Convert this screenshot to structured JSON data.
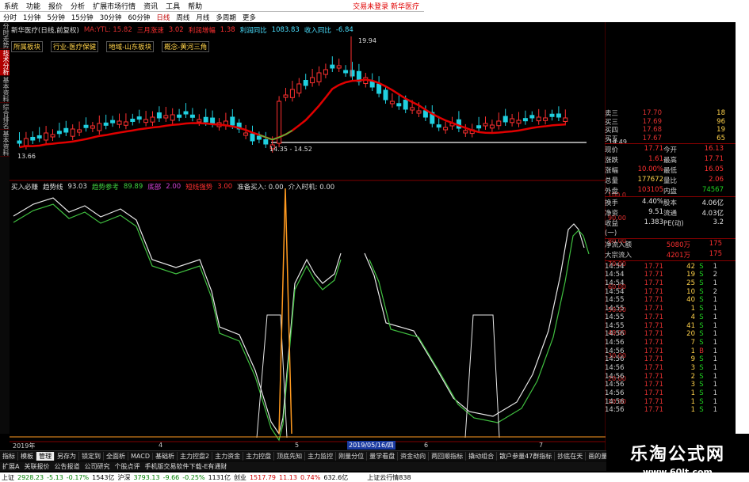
{
  "menu": {
    "items": [
      "系统",
      "功能",
      "报价",
      "分析",
      "扩展市场行情",
      "资讯",
      "工具",
      "帮助"
    ],
    "notice": "交易未登录",
    "stock_header": "新华医疗"
  },
  "periods": [
    "分时",
    "1分钟",
    "5分钟",
    "15分钟",
    "30分钟",
    "60分钟",
    "日线",
    "周线",
    "月线",
    "多周期",
    "更多"
  ],
  "left_tabs": [
    "分时走势",
    "技术分析",
    "基本资料",
    "综合排名",
    "基本资料"
  ],
  "info": {
    "title": "新华医疗(日线,前复权)",
    "ma": "MA:YTL: 15.82",
    "a": "三月涨速",
    "a_val": "3.02",
    "b": "利润增幅",
    "b_val": "1.38",
    "c": "利润同比",
    "c_val": "1083.83",
    "d": "收入同比",
    "d_val": "-6.84"
  },
  "tags": [
    "所属板块",
    "行业-医疗保健",
    "地域-山东板块",
    "概念-黄河三角"
  ],
  "indicator": {
    "name": "买入必赚",
    "trend": "趋势线",
    "trend_val": "93.03",
    "sig1": "趋势参考",
    "sig1_val": "89.89",
    "sig2": "底部",
    "sig2_val": "2.00",
    "sig3": "短线强势",
    "sig3_val": "3.00",
    "buy": "准备买入: 0.00",
    "buy2": "介入时机: 0.00"
  },
  "price_labels": {
    "high": "19.94",
    "low1": "13.66",
    "low2": "14.35 - 14.52",
    "right": "14.49"
  },
  "x_labels": {
    "a": "2019年",
    "b": "4",
    "c": "5",
    "d": "6",
    "e": "7",
    "date": "2019/05/16/四"
  },
  "osc_axis": [
    "100.0",
    "90.00",
    "80.00",
    "70.00",
    "60.00",
    "50.00",
    "40.00",
    "30.00",
    "20.00",
    "10.00"
  ],
  "quote": {
    "asks": [
      {
        "l": "卖三",
        "p": "17.70",
        "v": "18"
      },
      {
        "l": "买三",
        "p": "17.69",
        "v": "96"
      },
      {
        "l": "买四",
        "p": "17.68",
        "v": "19"
      },
      {
        "l": "买五",
        "p": "17.67",
        "v": "65"
      }
    ],
    "stats": [
      [
        "现价",
        "17.71",
        "今开",
        "16.13"
      ],
      [
        "涨跌",
        "1.61",
        "最高",
        "17.71"
      ],
      [
        "涨幅",
        "10.00%",
        "最低",
        "16.05"
      ],
      [
        "总量",
        "177672",
        "量比",
        "2.06"
      ],
      [
        "外盘",
        "103105",
        "内盘",
        "74567"
      ]
    ],
    "stats2": [
      [
        "换手",
        "4.40%",
        "股本",
        "4.06亿"
      ],
      [
        "净资",
        "9.51",
        "流通",
        "4.03亿"
      ],
      [
        "收益(一)",
        "1.383",
        "PE(动)",
        "3.2"
      ]
    ],
    "flows": [
      [
        "净流入额",
        "5080万",
        "175"
      ],
      [
        "大宗流入",
        "4201万",
        "175"
      ]
    ],
    "ticks": [
      [
        "14:54",
        "17.71",
        "42",
        "S",
        "1"
      ],
      [
        "14:54",
        "17.71",
        "19",
        "S",
        "2"
      ],
      [
        "14:54",
        "17.71",
        "25",
        "S",
        "1"
      ],
      [
        "14:54",
        "17.71",
        "10",
        "S",
        "2"
      ],
      [
        "14:55",
        "17.71",
        "40",
        "S",
        "1"
      ],
      [
        "14:55",
        "17.71",
        "1",
        "S",
        "1"
      ],
      [
        "14:55",
        "17.71",
        "4",
        "S",
        "1"
      ],
      [
        "14:55",
        "17.71",
        "41",
        "S",
        "1"
      ],
      [
        "14:56",
        "17.71",
        "20",
        "S",
        "1"
      ],
      [
        "14:56",
        "17.71",
        "7",
        "S",
        "1"
      ],
      [
        "14:56",
        "17.71",
        "1",
        "B",
        "1"
      ],
      [
        "14:56",
        "17.71",
        "9",
        "S",
        "1"
      ],
      [
        "14:56",
        "17.71",
        "3",
        "S",
        "1"
      ],
      [
        "14:56",
        "17.71",
        "2",
        "S",
        "1"
      ],
      [
        "14:56",
        "17.71",
        "3",
        "S",
        "1"
      ],
      [
        "14:56",
        "17.71",
        "1",
        "S",
        "1"
      ],
      [
        "14:56",
        "17.71",
        "1",
        "S",
        "1"
      ],
      [
        "14:56",
        "17.71",
        "1",
        "S",
        "1"
      ]
    ]
  },
  "bottom_tabs": [
    "指标",
    "模板",
    "管理",
    "另存为",
    "锁定到",
    "全面析",
    "MACD",
    "基础析",
    "主力控盘2",
    "主力资金",
    "主力控盘",
    "顶底先知",
    "主力监控",
    "刚量分位",
    "量学看盘",
    "资金动向",
    "两回顺指标",
    "撬动组合",
    "散户参量47群指标",
    "抄底在天",
    "画的量主",
    "暗黑超神"
  ],
  "ext_bar": [
    "扩展A",
    "关联报价",
    "公告报道",
    "公司研究",
    "个股点评",
    "手机版交易软件下载-E有通财"
  ],
  "status": {
    "sh_label": "上证",
    "sh_val": "2928.23",
    "sh_chg": "-5.13",
    "sh_pct": "-0.17%",
    "sh_amt": "1543亿",
    "hs_label": "沪深",
    "hs_val": "3793.13",
    "hs_chg": "-9.66",
    "hs_pct": "-0.25%",
    "hs_amt": "1131亿",
    "cy_label": "创业",
    "cy_val": "1517.79",
    "cy_chg": "11.13",
    "cy_pct": "0.74%",
    "cy_amt": "632.6亿",
    "info": "上证云行情838"
  },
  "brand": {
    "name": "乐淘公式网",
    "url": "www.60lt.com"
  },
  "colors": {
    "up": "#ff3030",
    "down": "#00ffff",
    "ma": "#e00000",
    "osc1": "#e8e8e8",
    "osc2": "#40c040",
    "signal": "#ff9a20"
  }
}
